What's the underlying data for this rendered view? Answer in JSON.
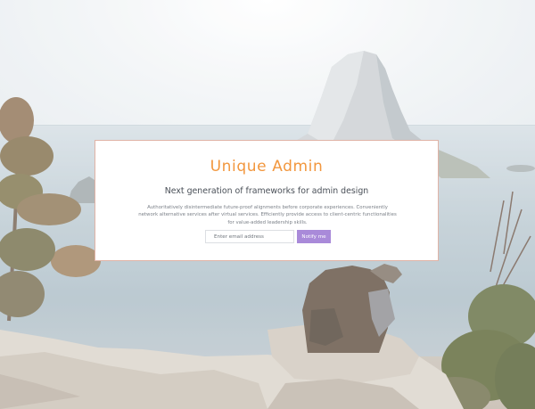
{
  "hero": {
    "title": "Unique Admin",
    "subtitle": "Next generation of frameworks for admin design",
    "description": "Authoritatively disintermediate future-proof alignments before corporate experiences. Conveniently network alternative services after virtual services. Efficiently provide access to client-centric functionalities for value-added leadership skills."
  },
  "form": {
    "email_placeholder": "Enter email address",
    "submit_label": "Notify me"
  },
  "colors": {
    "title": "#f2973e",
    "button": "#a98ad9",
    "card_border": "#e0b3a6"
  }
}
